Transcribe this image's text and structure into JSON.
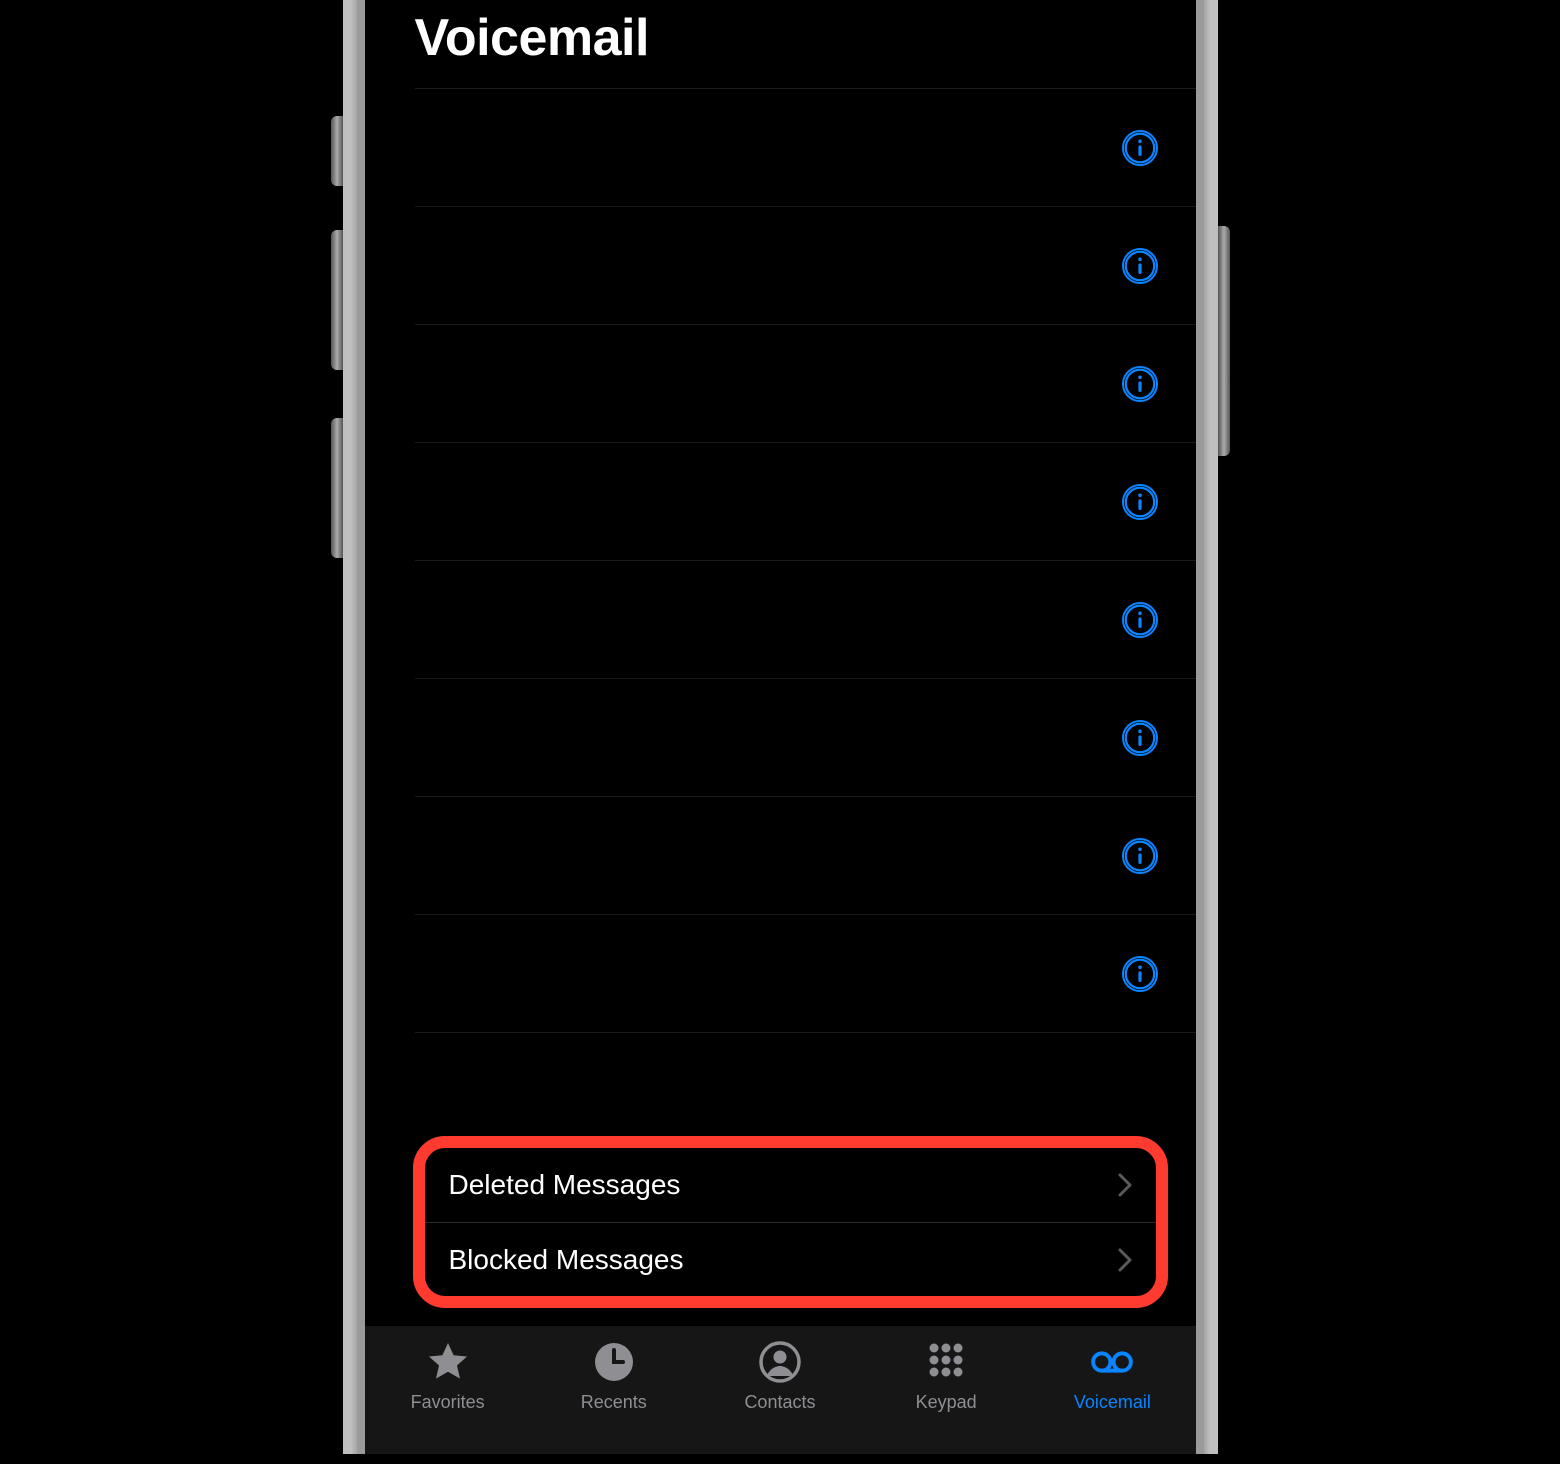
{
  "header": {
    "title": "Voicemail"
  },
  "voicemail_rows": 8,
  "highlight": {
    "deleted": "Deleted Messages",
    "blocked": "Blocked Messages"
  },
  "tabbar": {
    "favorites": "Favorites",
    "recents": "Recents",
    "contacts": "Contacts",
    "keypad": "Keypad",
    "voicemail": "Voicemail"
  },
  "colors": {
    "accent": "#0a84ff",
    "inactive": "#8e8e93",
    "highlight_border": "#ff3b30"
  }
}
